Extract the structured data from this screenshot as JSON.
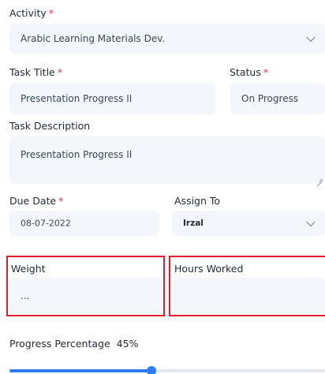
{
  "form": {
    "activity": {
      "label": "Activity",
      "value": "Arabic Learning Materials Dev."
    },
    "task_title": {
      "label": "Task Title",
      "value": "Presentation Progress II"
    },
    "status": {
      "label": "Status",
      "value": "On Progress"
    },
    "task_description": {
      "label": "Task Description",
      "value": "Presentation Progress II"
    },
    "due_date": {
      "label": "Due Date",
      "value": "08-07-2022"
    },
    "assign_to": {
      "label": "Assign To",
      "value": "Irzal"
    },
    "weight": {
      "label": "Weight",
      "value": "..."
    },
    "hours_worked": {
      "label": "Hours Worked",
      "value": ""
    },
    "progress": {
      "label": "Progress Percentage",
      "value_text": "45%",
      "fraction": 0.45
    }
  },
  "required_mark": "*",
  "colors": {
    "required": "#e0314b",
    "highlight": "#e01e2f",
    "accent": "#2f7cf6",
    "field_bg": "#f3f6fb"
  },
  "icons": {
    "dropdown": "chevron-down-icon",
    "resize": "resize-handle-icon"
  }
}
